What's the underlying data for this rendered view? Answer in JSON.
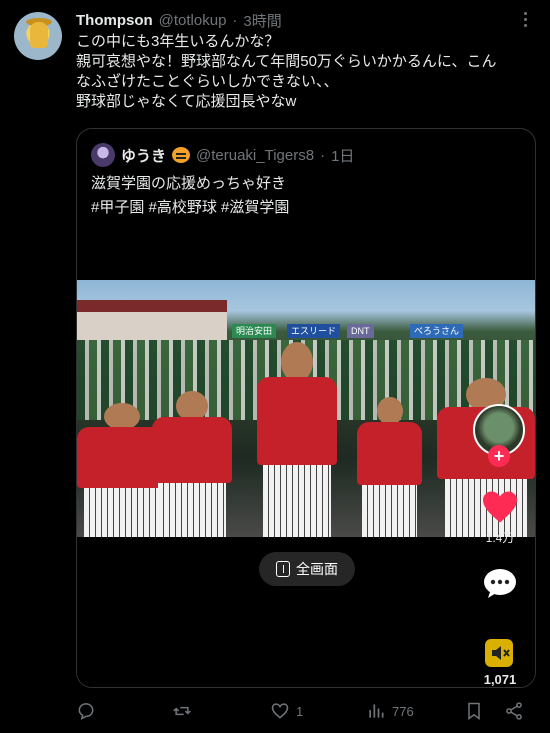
{
  "tweet": {
    "display_name": "Thompson",
    "handle": "@totlokup",
    "separator": "·",
    "time": "3時間",
    "lines": [
      "この中にも3年生いるんかな？",
      "親可哀想やな！野球部なんて年間50万ぐらいかかるんに、こん",
      "なふざけたことぐらいしかできない、、",
      "野球部じゃなくて応援団長やなw"
    ]
  },
  "quote": {
    "display_name": "ゆうき",
    "emoji": "tiger-face-icon",
    "handle": "@teruaki_Tigers8",
    "separator": "·",
    "time": "1日",
    "text": "滋賀学園の応援めっちゃ好き",
    "hashtags": "#甲子園 #高校野球 #滋賀学園"
  },
  "video": {
    "fullscreen_label": "全画面",
    "likes": "1.4万",
    "shares": "1,071",
    "scene_boards": [
      "明治安田",
      "エスリード",
      "DNT",
      "べろうさん"
    ]
  },
  "actions": {
    "reply_count": "",
    "retweet_count": "",
    "like_count": "1",
    "views_count": "776"
  },
  "colors": {
    "background": "#000000",
    "text": "#e7e9ea",
    "muted": "#71767b",
    "border": "#2f3336",
    "tiktok_red": "#fe2c55"
  }
}
